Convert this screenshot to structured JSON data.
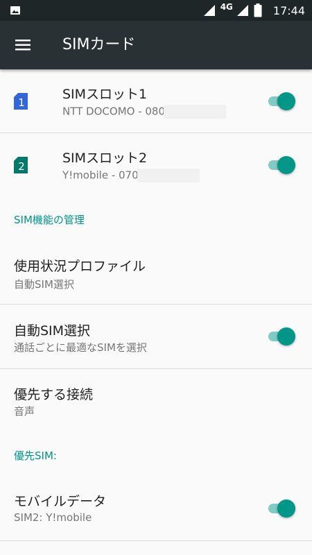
{
  "status_bar": {
    "network": "4G",
    "time": "17:44",
    "icons": [
      "image-notification-icon",
      "signal-icon",
      "signal-icon",
      "battery-icon"
    ]
  },
  "app_bar": {
    "title": "SIMカード",
    "menu_icon": "hamburger-menu-icon"
  },
  "sim_slots": [
    {
      "title": "SIMスロット1",
      "subtitle": "NTT DOCOMO - 080",
      "badge": "1",
      "badge_color": "#3367d6",
      "enabled": true
    },
    {
      "title": "SIMスロット2",
      "subtitle": "Y!mobile - 070",
      "badge": "2",
      "badge_color": "#00796b",
      "enabled": true
    }
  ],
  "sim_function_section": {
    "header": "SIM機能の管理",
    "usage_profile": {
      "title": "使用状況プロファイル",
      "subtitle": "自動SIM選択"
    },
    "auto_sim": {
      "title": "自動SIM選択",
      "subtitle": "通話ごとに最適なSIMを選択",
      "enabled": true
    },
    "preferred_connection": {
      "title": "優先する接続",
      "subtitle": "音声"
    }
  },
  "preferred_sim_section": {
    "header": "優先SIM:",
    "mobile_data": {
      "title": "モバイルデータ",
      "subtitle": "SIM2: Y!mobile",
      "enabled": true
    }
  },
  "colors": {
    "accent": "#009688",
    "toggle_track": "#80cbc4",
    "app_bar": "#2a3134",
    "status_bar": "#1f2628"
  }
}
